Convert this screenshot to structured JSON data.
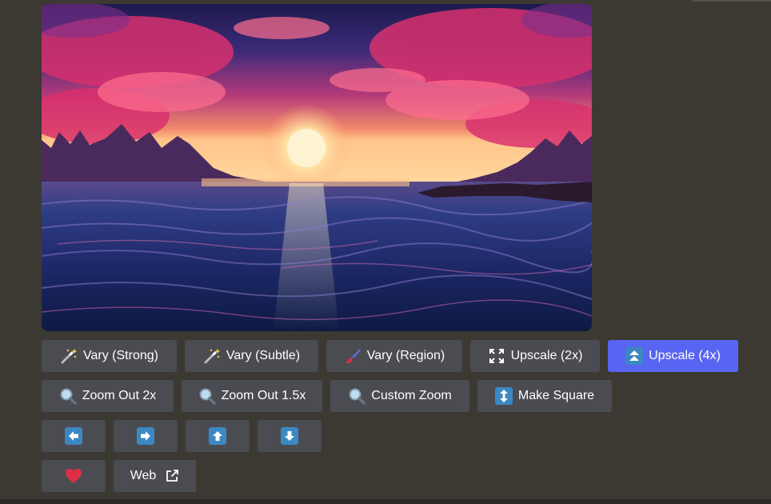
{
  "image": {
    "alt": "",
    "colors": {
      "sky_top": "#2a1f5c",
      "sky_mid": "#c2306a",
      "horizon": "#f59a6a",
      "sun": "#fff2c8",
      "water": "#1a2a6a"
    }
  },
  "buttons_row1": [
    {
      "label": "Vary (Strong)",
      "icon": "magic-wand-icon"
    },
    {
      "label": "Vary (Subtle)",
      "icon": "magic-wand-icon"
    },
    {
      "label": "Vary (Region)",
      "icon": "paintbrush-icon"
    },
    {
      "label": "Upscale (2x)",
      "icon": "expand-icon"
    },
    {
      "label": "Upscale (4x)",
      "icon": "double-up-arrow-icon"
    }
  ],
  "buttons_row2": [
    {
      "label": "Zoom Out 2x",
      "icon": "magnifier-icon"
    },
    {
      "label": "Zoom Out 1.5x",
      "icon": "magnifier-icon"
    },
    {
      "label": "Custom Zoom",
      "icon": "magnifier-icon"
    },
    {
      "label": "Make Square",
      "icon": "up-down-arrow-icon"
    }
  ],
  "pan_buttons": [
    {
      "direction": "left",
      "icon": "arrow-left-icon"
    },
    {
      "direction": "right",
      "icon": "arrow-right-icon"
    },
    {
      "direction": "up",
      "icon": "arrow-up-icon"
    },
    {
      "direction": "down",
      "icon": "arrow-down-icon"
    }
  ],
  "buttons_row4": {
    "favorite_icon": "heart-icon",
    "web_label": "Web",
    "web_icon": "external-link-icon"
  },
  "colors": {
    "background": "#3c3932",
    "button": "#4a4c52",
    "primary": "#5865f2",
    "emoji_blue": "#3b88c3",
    "heart": "#dd2e44"
  }
}
